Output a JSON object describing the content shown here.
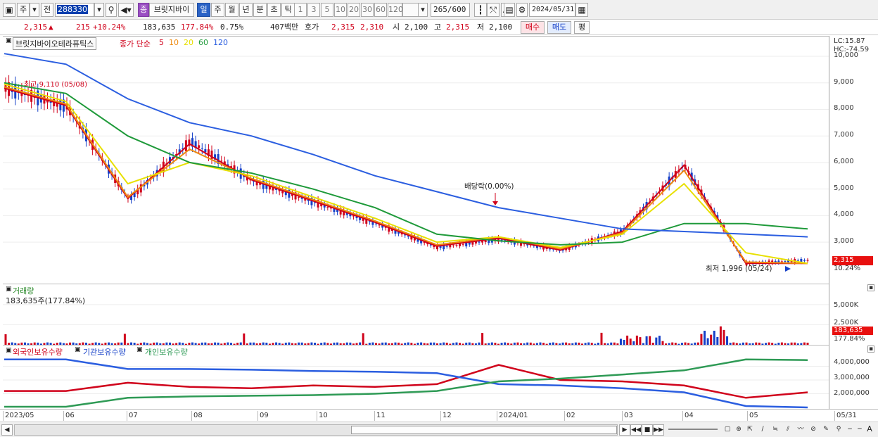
{
  "toolbar": {
    "market": "주",
    "prev": "전",
    "code": "288330",
    "stock_badge": "종",
    "stock_name": "브릿지바이",
    "periods": [
      "일",
      "주",
      "월",
      "년",
      "분",
      "초",
      "틱"
    ],
    "selected_period": "일",
    "intervals": [
      "1",
      "3",
      "5",
      "10",
      "20",
      "30",
      "60",
      "120"
    ],
    "count": "265",
    "count_total": "/600",
    "date": "2024/05/31"
  },
  "quote": {
    "price": "2,315",
    "arrow": "▲",
    "change": "215",
    "change_pct": "+10.24%",
    "volume": "183,635",
    "volume_ratio": "177.84%",
    "turnover": "0.75%",
    "amount": "407백만",
    "hoga_label": "호가",
    "ask": "2,315",
    "bid": "2,310",
    "open_label": "시",
    "open": "2,100",
    "high_label": "고",
    "high": "2,315",
    "low_label": "저",
    "low": "2,100",
    "buy_label": "매수",
    "sell_label": "매도",
    "avg_label": "평"
  },
  "price_panel": {
    "stock_name": "브릿지바이오테라퓨틱스",
    "ma_prefix": "종가 단순",
    "ma_periods": [
      "5",
      "10",
      "20",
      "60",
      "120"
    ],
    "ma_colors": [
      "#d0021b",
      "#ee8a10",
      "#e8e000",
      "#1f9a3a",
      "#2b5ee0"
    ],
    "high_note": "최고 9,110 (05/08)",
    "low_note": "최저 1,996 (05/24)",
    "dividend_note": "배당락(0.00%)",
    "lc": "LC:15.87",
    "hc": "HC:-74.59",
    "y_ticks": [
      "10,000",
      "9,000",
      "8,000",
      "7,000",
      "6,000",
      "5,000",
      "4,000",
      "3,000"
    ],
    "last_price": "2,315",
    "last_pct": "10.24%"
  },
  "volume_panel": {
    "title": "거래량",
    "value": "183,635주(177.84%)",
    "y_ticks": [
      "5,000K",
      "2,500K"
    ],
    "last_value": "183,635",
    "last_pct": "177.84%"
  },
  "holding_panel": {
    "foreign": "외국인보유수량",
    "institution": "기관보유수량",
    "individual": "개인보유수량",
    "y_ticks": [
      "4,000,000",
      "3,000,000",
      "2,000,000"
    ]
  },
  "date_axis": [
    "2023/05",
    "06",
    "07",
    "08",
    "09",
    "10",
    "11",
    "12",
    "2024/01",
    "02",
    "03",
    "04",
    "05"
  ],
  "date_axis_right": "05/31",
  "chart_data": {
    "type": "line",
    "title": "브릿지바이오테라퓨틱스",
    "x": [
      "2023/05",
      "06",
      "07",
      "08",
      "09",
      "10",
      "11",
      "12",
      "2024/01",
      "02",
      "03",
      "04",
      "05",
      "05/31"
    ],
    "series": [
      {
        "name": "종가",
        "values": [
          8800,
          8100,
          4600,
          6800,
          5300,
          4500,
          3700,
          2800,
          3100,
          2700,
          3400,
          5900,
          2200,
          2315
        ]
      },
      {
        "name": "5",
        "values": [
          8800,
          8150,
          4650,
          6700,
          5350,
          4550,
          3750,
          2850,
          3150,
          2700,
          3400,
          5900,
          2200,
          2200
        ]
      },
      {
        "name": "10",
        "values": [
          8850,
          8200,
          4700,
          6500,
          5400,
          4600,
          3800,
          2900,
          3200,
          2750,
          3350,
          5700,
          2250,
          2200
        ]
      },
      {
        "name": "20",
        "values": [
          8950,
          8300,
          5200,
          6000,
          5500,
          4700,
          3900,
          3000,
          3200,
          2800,
          3300,
          5200,
          2600,
          2200
        ]
      },
      {
        "name": "60",
        "values": [
          9000,
          8600,
          7000,
          6000,
          5600,
          5000,
          4300,
          3300,
          3050,
          2900,
          3000,
          3700,
          3700,
          3500
        ]
      },
      {
        "name": "120",
        "values": [
          10100,
          9700,
          8400,
          7500,
          7000,
          6300,
          5500,
          4900,
          4300,
          3900,
          3500,
          3400,
          3300,
          3200
        ]
      }
    ],
    "ylim": [
      1996,
      10000
    ],
    "volume_ylim": [
      0,
      7000000
    ],
    "holdings": {
      "x": [
        "2023/05",
        "06",
        "07",
        "08",
        "09",
        "10",
        "11",
        "12",
        "2024/01",
        "02",
        "03",
        "04",
        "05",
        "05/31"
      ],
      "series": [
        {
          "name": "외국인보유수량",
          "color": "#d0021b",
          "values": [
            2200000,
            2200000,
            2800000,
            2500000,
            2400000,
            2600000,
            2500000,
            2700000,
            4100000,
            3000000,
            2900000,
            2600000,
            1700000,
            2100000
          ]
        },
        {
          "name": "기관보유수량",
          "color": "#2b5ee0",
          "values": [
            4500000,
            4500000,
            3800000,
            3800000,
            3750000,
            3650000,
            3600000,
            3500000,
            2700000,
            2600000,
            2400000,
            2100000,
            1100000,
            1000000
          ]
        },
        {
          "name": "개인보유수량",
          "color": "#2e9a55",
          "values": [
            1050000,
            1050000,
            1700000,
            1800000,
            1850000,
            1900000,
            2000000,
            2200000,
            2900000,
            3100000,
            3400000,
            3700000,
            4500000,
            4450000
          ]
        }
      ],
      "ylim": [
        1000000,
        5000000
      ]
    }
  }
}
